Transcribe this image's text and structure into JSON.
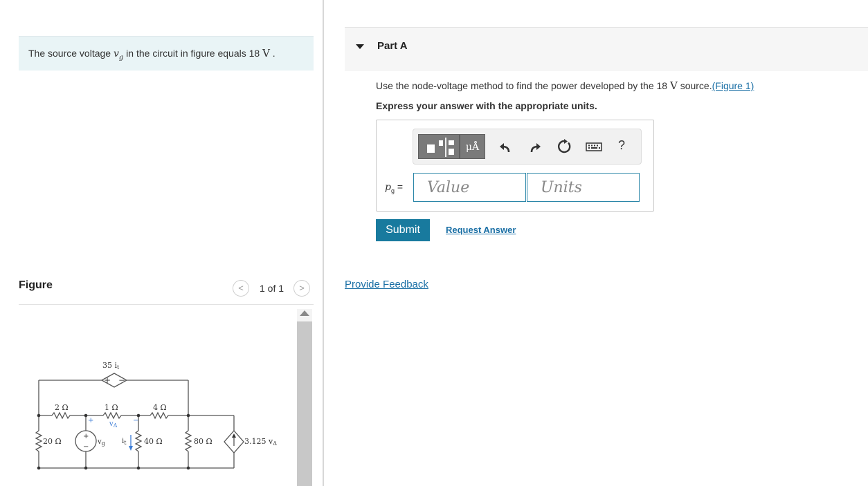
{
  "intro": {
    "prefix": "The source voltage ",
    "variable": "v",
    "variable_sub": "g",
    "middle": " in the circuit in figure equals 18 ",
    "unit": "V",
    "suffix": " ."
  },
  "figure_panel": {
    "title": "Figure",
    "pager": "1 of 1",
    "prev_glyph": "<",
    "next_glyph": ">"
  },
  "circuit": {
    "labels": {
      "dep_source": "35 i",
      "dep_source_sub": "t",
      "r_2": "2 Ω",
      "r_1": "1 Ω",
      "r_4": "4 Ω",
      "r_20": "20 Ω",
      "r_40": "40 Ω",
      "r_80": "80 Ω",
      "v_delta": "v",
      "v_delta_sub": "Δ",
      "v_g": "v",
      "v_g_sub": "g",
      "i_t": "i",
      "i_t_sub": "t",
      "cccs": "3.125 v",
      "cccs_sub": "Δ",
      "plus": "+",
      "minus": "−"
    }
  },
  "part": {
    "label": "Part A",
    "question_pre": "Use the node-voltage method to find the power developed by the 18 ",
    "question_unit": "V",
    "question_post": " source.",
    "figure_link": "(Figure 1)",
    "instruction": "Express your answer with the appropriate units."
  },
  "answer": {
    "variable": "p",
    "variable_sub": "g",
    "equals": " =",
    "value_placeholder": "Value",
    "units_placeholder": "Units",
    "unit_button": "μÅ",
    "help": "?"
  },
  "icons": {
    "templates": "templates-icon",
    "units": "units-icon",
    "undo": "undo-icon",
    "redo": "redo-icon",
    "reset": "reset-icon",
    "keyboard": "keyboard-icon",
    "help": "help-icon"
  },
  "actions": {
    "submit": "Submit",
    "request_answer": "Request Answer",
    "provide_feedback": "Provide Feedback"
  },
  "colors": {
    "intro_bg": "#e9f4f6",
    "accent": "#187a9e",
    "link": "#1a6fa5",
    "input_border": "#2b86a8"
  }
}
